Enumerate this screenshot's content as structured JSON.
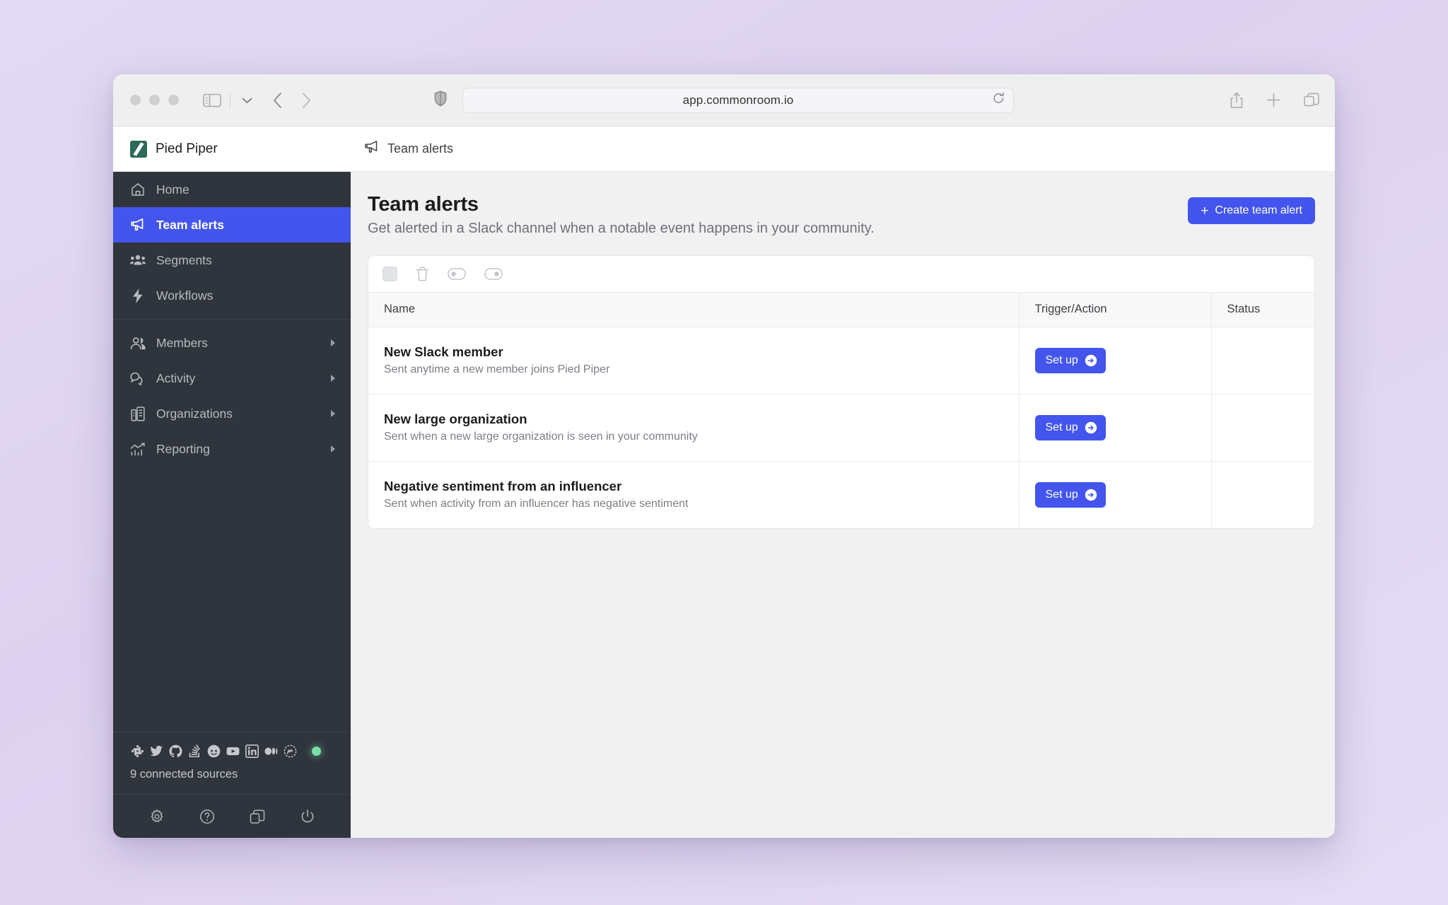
{
  "browser": {
    "url": "app.commonroom.io",
    "traffic_lights": [
      "close",
      "minimize",
      "maximize"
    ],
    "icons": {
      "sidebar_toggle": "sidebar-toggle-icon",
      "tab_group_chevron": "chevron-down-icon",
      "back": "back-arrow-icon",
      "forward": "forward-arrow-icon",
      "shield": "shield-icon",
      "reload": "reload-icon",
      "share": "share-icon",
      "new_tab": "plus-icon",
      "tab_overview": "tab-overview-icon"
    }
  },
  "topbar": {
    "workspace_name": "Pied Piper",
    "logo": "pied-piper-logo",
    "breadcrumb_icon": "megaphone-icon",
    "breadcrumb_label": "Team alerts"
  },
  "sidebar": {
    "items": [
      {
        "label": "Home",
        "icon": "home-icon",
        "active": false,
        "has_caret": false
      },
      {
        "label": "Team alerts",
        "icon": "megaphone-icon",
        "active": true,
        "has_caret": false
      },
      {
        "label": "Segments",
        "icon": "segments-icon",
        "active": false,
        "has_caret": false
      },
      {
        "label": "Workflows",
        "icon": "lightning-icon",
        "active": false,
        "has_caret": false
      },
      {
        "label": "Members",
        "icon": "members-icon",
        "active": false,
        "has_caret": true
      },
      {
        "label": "Activity",
        "icon": "activity-icon",
        "active": false,
        "has_caret": true
      },
      {
        "label": "Organizations",
        "icon": "organizations-icon",
        "active": false,
        "has_caret": true
      },
      {
        "label": "Reporting",
        "icon": "reporting-icon",
        "active": false,
        "has_caret": true
      }
    ],
    "sources": {
      "label": "9 connected sources",
      "icons": [
        "slack-icon",
        "twitter-icon",
        "github-icon",
        "stackoverflow-icon",
        "reddit-icon",
        "youtube-icon",
        "linkedin-icon",
        "medium-icon",
        "meetup-icon"
      ],
      "status_dot_color": "#7ae0a8"
    },
    "footer_icons": [
      "gear-icon",
      "help-icon",
      "switch-workspace-icon",
      "power-icon"
    ]
  },
  "main": {
    "title": "Team alerts",
    "subtitle": "Get alerted in a Slack channel when a notable event happens in your community.",
    "create_button": {
      "label": "Create team alert",
      "plus": "+"
    },
    "table_toolbar_icons": [
      "select-all-checkbox",
      "trash-icon",
      "toggle-off-icon",
      "toggle-on-icon"
    ],
    "columns": [
      "Name",
      "Trigger/Action",
      "Status"
    ],
    "rows": [
      {
        "name": "New Slack member",
        "description": "Sent anytime a new member joins Pied Piper",
        "action_label": "Set up",
        "status": ""
      },
      {
        "name": "New large organization",
        "description": "Sent when a new large organization is seen in your community",
        "action_label": "Set up",
        "status": ""
      },
      {
        "name": "Negative sentiment from an influencer",
        "description": "Sent when activity from an influencer has negative sentiment",
        "action_label": "Set up",
        "status": ""
      }
    ]
  },
  "colors": {
    "accent": "#4355ed",
    "sidebar_bg": "#2f343d",
    "page_bg": "#f1f1f2",
    "status_green": "#7ae0a8",
    "logo_green": "#2d6a5a"
  }
}
